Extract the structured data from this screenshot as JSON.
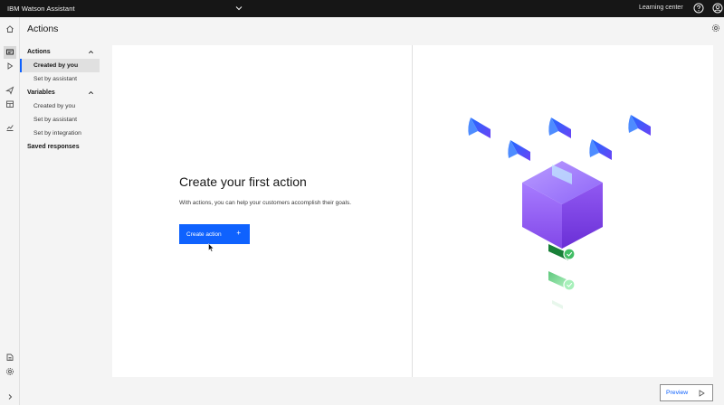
{
  "topbar": {
    "brand": "IBM Watson Assistant",
    "learning_center": "Learning center",
    "icons": [
      "chevron-down-icon",
      "help-icon",
      "user-icon"
    ]
  },
  "rail": {
    "icons": [
      "home-icon",
      "actions-icon",
      "preview-play-icon",
      "publish-icon",
      "integrations-icon",
      "analytics-icon",
      "document-icon",
      "settings-icon",
      "expand-icon"
    ]
  },
  "header": {
    "title": "Actions"
  },
  "sidenav": {
    "actions_heading": "Actions",
    "actions_items": [
      {
        "label": "Created by you"
      },
      {
        "label": "Set by assistant"
      }
    ],
    "variables_heading": "Variables",
    "variables_items": [
      {
        "label": "Created by you"
      },
      {
        "label": "Set by assistant"
      },
      {
        "label": "Set by integration"
      }
    ],
    "saved_responses": "Saved responses"
  },
  "main": {
    "empty_title": "Create your first action",
    "empty_desc": "With actions, you can help your customers accomplish their goals.",
    "create_button": "Create action",
    "create_button_icon": "+"
  },
  "footer": {
    "preview_button": "Preview"
  },
  "colors": {
    "accent": "#0f62fe",
    "topbar": "#161616",
    "cube": "#8a5cf6"
  }
}
